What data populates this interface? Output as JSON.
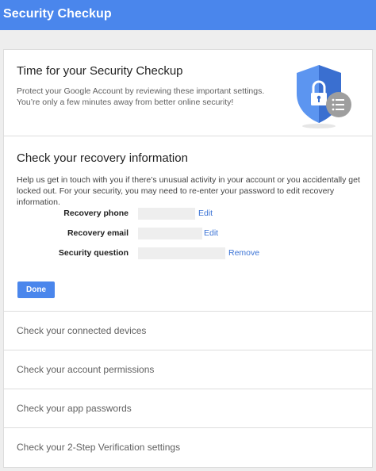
{
  "appbar": {
    "title": "Security Checkup"
  },
  "intro": {
    "title": "Time for your Security Checkup",
    "description": "Protect your Google Account by reviewing these important settings. You’re only a few minutes away from better online security!"
  },
  "recovery": {
    "title": "Check your recovery information",
    "description": "Help us get in touch with you if there’s unusual activity in your account or you accidentally get locked out. For your security, you may need to re-enter your password to edit recovery information.",
    "fields": [
      {
        "label": "Recovery phone",
        "value": "",
        "link": "Edit"
      },
      {
        "label": "Recovery email",
        "value": "",
        "link": "Edit"
      },
      {
        "label": "Security question",
        "value": "",
        "link": "Remove"
      }
    ],
    "done_label": "Done"
  },
  "checks": [
    {
      "label": "Check your connected devices"
    },
    {
      "label": "Check your account permissions"
    },
    {
      "label": "Check your app passwords"
    },
    {
      "label": "Check your 2-Step Verification settings"
    }
  ],
  "colors": {
    "accent": "#4a86ec",
    "link": "#3b73d5",
    "shield_light": "#5c95f0",
    "shield_dark": "#3a6fd0",
    "badge": "#9e9e9e"
  },
  "icons": {
    "shield": "shield-lock-icon",
    "list_badge": "list-icon"
  }
}
